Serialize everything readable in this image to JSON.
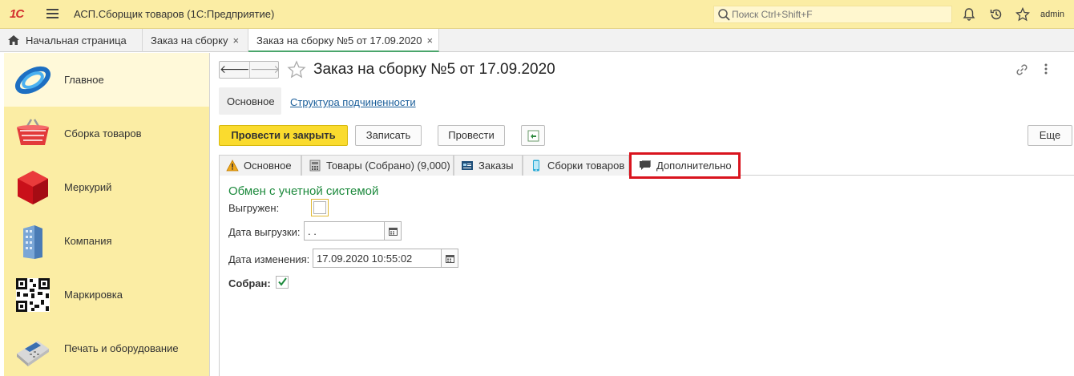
{
  "window": {
    "logo": "1С",
    "title": "АСП.Сборщик товаров  (1С:Предприятие)",
    "search_placeholder": "Поиск Ctrl+Shift+F",
    "user": "admin"
  },
  "open_tabs": [
    {
      "label": "Начальная страница",
      "closable": false,
      "icon": "home-icon"
    },
    {
      "label": "Заказ на сборку",
      "closable": true
    },
    {
      "label": "Заказ на сборку №5 от 17.09.2020",
      "closable": true,
      "active": true
    }
  ],
  "close_glyph": "×",
  "sidebar": {
    "items": [
      {
        "label": "Главное",
        "icon": "main-section-icon",
        "active": true
      },
      {
        "label": "Сборка товаров",
        "icon": "basket-icon"
      },
      {
        "label": "Меркурий",
        "icon": "cube-icon"
      },
      {
        "label": "Компания",
        "icon": "building-icon"
      },
      {
        "label": "Маркировка",
        "icon": "qr-code-icon"
      },
      {
        "label": "Печать и оборудование",
        "icon": "pos-terminal-icon"
      }
    ]
  },
  "document": {
    "back": "🡐",
    "forward": "🡒",
    "title": "Заказ на сборку №5 от 17.09.2020",
    "subtabs": {
      "active": "Основное",
      "link": "Структура подчиненности"
    },
    "toolbar": {
      "post_close": "Провести и закрыть",
      "save": "Записать",
      "post": "Провести",
      "more": "Еще"
    },
    "form_tabs": [
      {
        "label": "Основное",
        "icon": "warning-icon"
      },
      {
        "label": "Товары (Собрано) (9,000)",
        "icon": "cash-register-icon"
      },
      {
        "label": "Заказы",
        "icon": "orders-icon"
      },
      {
        "label": "Сборки товаров",
        "icon": "phone-icon"
      },
      {
        "label": "Дополнительно",
        "icon": "comment-icon",
        "active": true
      }
    ],
    "exchange": {
      "group_title": "Обмен с учетной системой",
      "exported_label": "Выгружен:",
      "exported_checked": false,
      "export_date_label": "Дата выгрузки:",
      "export_date_value": "  .  .",
      "changed_date_label": "Дата изменения:",
      "changed_date_value": "17.09.2020 10:55:02",
      "collected_label": "Собран:",
      "collected_checked": true
    }
  },
  "colors": {
    "title_bar": "#fbeda4",
    "accent_green": "#1d8a3d",
    "primary_button": "#fadb2e",
    "highlight_red": "#d9141e",
    "link_blue": "#1a5e9a"
  }
}
